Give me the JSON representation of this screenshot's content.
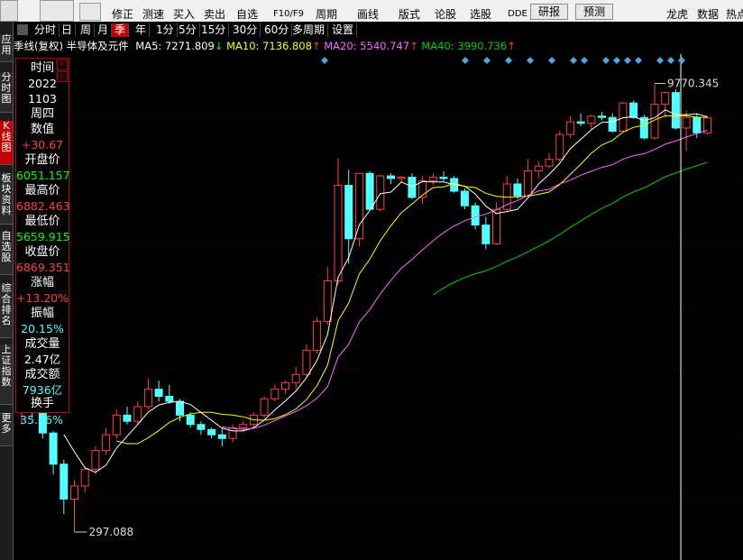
{
  "toolbar": {
    "items": [
      {
        "label": "修正",
        "icon": "edit-icon"
      },
      {
        "label": "测速",
        "icon": "speed-icon"
      },
      {
        "label": "买入",
        "icon": "buy-icon"
      },
      {
        "label": "卖出",
        "icon": "sell-icon"
      },
      {
        "label": "自选",
        "icon": "favorite-icon"
      },
      {
        "label": "F10/F9",
        "icon": "f10-icon"
      },
      {
        "label": "周期",
        "icon": "period-icon"
      },
      {
        "label": "画线",
        "icon": "draw-icon"
      },
      {
        "label": "版式",
        "icon": "layout-icon"
      },
      {
        "label": "论股",
        "icon": "forum-icon"
      },
      {
        "label": "选股",
        "icon": "select-stock-icon"
      },
      {
        "label": "DDE",
        "icon": "dde-icon"
      }
    ],
    "research_label": "研报",
    "forecast_label": "预测",
    "right_items": [
      {
        "label": "龙虎",
        "icon": "dragon-tiger-icon"
      },
      {
        "label": "数据",
        "icon": "data-icon"
      },
      {
        "label": "热点",
        "icon": "hotspot-icon"
      }
    ]
  },
  "leftbar": {
    "items": [
      {
        "label": "应用"
      },
      {
        "label": "分时图"
      },
      {
        "label": "K线图",
        "active": true
      },
      {
        "label": "板块资料"
      },
      {
        "label": "自选股"
      },
      {
        "label": "综合排名"
      },
      {
        "label": "上证指数"
      },
      {
        "label": "更多"
      }
    ]
  },
  "periods": {
    "items": [
      "分时",
      "日",
      "周",
      "月",
      "季",
      "年",
      "1分",
      "5分",
      "15分",
      "30分",
      "60分",
      "多周期",
      "设置"
    ],
    "active": "季"
  },
  "ma_line": {
    "title": "季线(复权) 半导体及元件",
    "ma5": {
      "label": "MA5: 7271.809",
      "arrow": "↓",
      "color": "#ffffff"
    },
    "ma10": {
      "label": "MA10: 7136.808",
      "arrow": "↑",
      "color": "#ffff00"
    },
    "ma20": {
      "label": "MA20: 5540.747",
      "arrow": "↑",
      "color": "#ff66ff"
    },
    "ma40": {
      "label": "MA40: 3990.736",
      "arrow": "↑",
      "color": "#00cc00"
    }
  },
  "info": {
    "time_label": "时间",
    "year": "2022",
    "date": "1103",
    "weekday": "周四",
    "value_label": "数值",
    "value": "+30.67",
    "open_label": "开盘价",
    "open": "6051.157",
    "high_label": "最高价",
    "high": "6882.463",
    "low_label": "最低价",
    "low": "5659.915",
    "close_label": "收盘价",
    "close": "6869.351",
    "change_label": "涨幅",
    "change": "+13.20%",
    "amplitude_label": "振幅",
    "amplitude": "20.15%",
    "volume_label": "成交量",
    "volume": "2.47亿",
    "turnover_amount_label": "成交额",
    "turnover_amount": "7936亿",
    "turnover_label": "换手",
    "turnover_rate": "35.66%",
    "close_icon": "✕",
    "settings_icon": "◎"
  },
  "chart_data": {
    "type": "candlestick",
    "max_label": "9770.345",
    "min_label": "297.088",
    "ylim": [
      100,
      10000
    ],
    "up_color": "#ff4040",
    "down_color": "#50ffff",
    "candles": [
      [
        360,
        395,
        300,
        380
      ],
      [
        380,
        420,
        320,
        360
      ],
      [
        360,
        370,
        260,
        275
      ],
      [
        275,
        280,
        180,
        200
      ],
      [
        200,
        210,
        120,
        140
      ],
      [
        140,
        170,
        100,
        160
      ],
      [
        160,
        195,
        150,
        190
      ],
      [
        190,
        240,
        180,
        230
      ],
      [
        230,
        290,
        220,
        270
      ],
      [
        270,
        350,
        260,
        330
      ],
      [
        330,
        360,
        300,
        310
      ],
      [
        310,
        380,
        300,
        360
      ],
      [
        360,
        480,
        350,
        430
      ],
      [
        430,
        470,
        380,
        400
      ],
      [
        400,
        450,
        370,
        380
      ],
      [
        380,
        390,
        310,
        330
      ],
      [
        330,
        340,
        290,
        300
      ],
      [
        300,
        310,
        270,
        285
      ],
      [
        285,
        290,
        260,
        270
      ],
      [
        270,
        290,
        240,
        260
      ],
      [
        260,
        300,
        250,
        290
      ],
      [
        290,
        310,
        280,
        300
      ],
      [
        300,
        340,
        290,
        330
      ],
      [
        330,
        400,
        320,
        390
      ],
      [
        390,
        450,
        380,
        430
      ],
      [
        430,
        470,
        410,
        460
      ],
      [
        460,
        540,
        430,
        500
      ],
      [
        500,
        680,
        490,
        640
      ],
      [
        640,
        900,
        620,
        860
      ],
      [
        860,
        1500,
        830,
        1300
      ],
      [
        1300,
        4550,
        1250,
        3450
      ],
      [
        3450,
        4050,
        1550,
        2000
      ],
      [
        2000,
        3900,
        1850,
        3900
      ],
      [
        3900,
        3980,
        2750,
        2700
      ],
      [
        2700,
        3850,
        2650,
        3800
      ],
      [
        3800,
        3900,
        3500,
        3700
      ],
      [
        3700,
        3800,
        3550,
        3750
      ],
      [
        3750,
        3900,
        3000,
        3050
      ],
      [
        3050,
        3800,
        2850,
        3620
      ],
      [
        3620,
        3900,
        3450,
        3750
      ],
      [
        3750,
        3980,
        3600,
        3700
      ],
      [
        3700,
        3800,
        3200,
        3250
      ],
      [
        3250,
        3350,
        2700,
        2800
      ],
      [
        2800,
        2900,
        2200,
        2300
      ],
      [
        2300,
        2500,
        1800,
        1900
      ],
      [
        1900,
        2900,
        1880,
        2700
      ],
      [
        2700,
        3800,
        2650,
        3500
      ],
      [
        3500,
        3700,
        3000,
        3100
      ],
      [
        3100,
        4500,
        3050,
        4000
      ],
      [
        4000,
        4400,
        3700,
        4200
      ],
      [
        4200,
        4800,
        4100,
        4500
      ],
      [
        4500,
        6000,
        4400,
        5800
      ],
      [
        5800,
        7000,
        5600,
        6600
      ],
      [
        6600,
        7200,
        6300,
        6500
      ],
      [
        6500,
        7100,
        6100,
        7000
      ],
      [
        7000,
        7300,
        6700,
        6900
      ],
      [
        6900,
        7200,
        5900,
        6000
      ],
      [
        6000,
        8100,
        5900,
        8000
      ],
      [
        8000,
        8200,
        6800,
        6900
      ],
      [
        6900,
        7100,
        5500,
        5600
      ],
      [
        5600,
        9770,
        5500,
        7900
      ],
      [
        7900,
        9000,
        6900,
        8900
      ],
      [
        8900,
        9200,
        6100,
        6200
      ],
      [
        6200,
        7400,
        4900,
        6900
      ],
      [
        6900,
        7200,
        5600,
        5900
      ],
      [
        5900,
        7000,
        5800,
        6869
      ]
    ],
    "ma5": "computed",
    "ma10": "computed",
    "ma20": "computed",
    "ma40": "computed"
  }
}
